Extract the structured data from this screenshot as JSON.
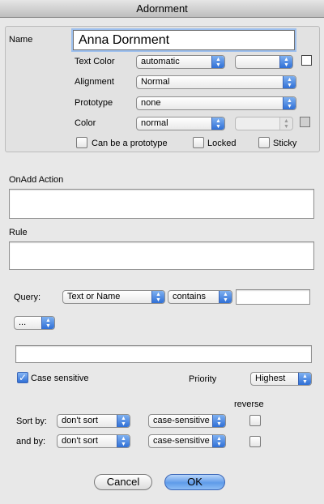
{
  "window": {
    "title": "Adornment"
  },
  "panel": {
    "name_label": "Name",
    "name_value": "Anna Dornment",
    "text_color": {
      "label": "Text Color",
      "value": "automatic",
      "secondary_value": ""
    },
    "alignment": {
      "label": "Alignment",
      "value": "Normal"
    },
    "prototype": {
      "label": "Prototype",
      "value": "none"
    },
    "color": {
      "label": "Color",
      "value": "normal",
      "secondary_value": ""
    },
    "checkboxes": {
      "can_be_prototype": {
        "label": "Can be a prototype",
        "checked": false
      },
      "locked": {
        "label": "Locked",
        "checked": false
      },
      "sticky": {
        "label": "Sticky",
        "checked": false
      }
    }
  },
  "onadd": {
    "label": "OnAdd Action",
    "value": ""
  },
  "rule": {
    "label": "Rule",
    "value": ""
  },
  "query": {
    "label": "Query:",
    "field": "Text or Name",
    "operator": "contains",
    "value": "",
    "extra": "...",
    "expression": ""
  },
  "case_sensitive": {
    "label": "Case sensitive",
    "checked": true
  },
  "priority": {
    "label": "Priority",
    "value": "Highest"
  },
  "sort": {
    "reverse_label": "reverse",
    "sort_by": {
      "label": "Sort by:",
      "order": "don't sort",
      "case": "case-sensitive",
      "reverse": false
    },
    "and_by": {
      "label": "and by:",
      "order": "don't sort",
      "case": "case-sensitive",
      "reverse": false
    }
  },
  "buttons": {
    "cancel": "Cancel",
    "ok": "OK"
  },
  "icons": {
    "popup_arrow": "updown-arrow-icon",
    "checkmark": "checkmark-icon"
  }
}
